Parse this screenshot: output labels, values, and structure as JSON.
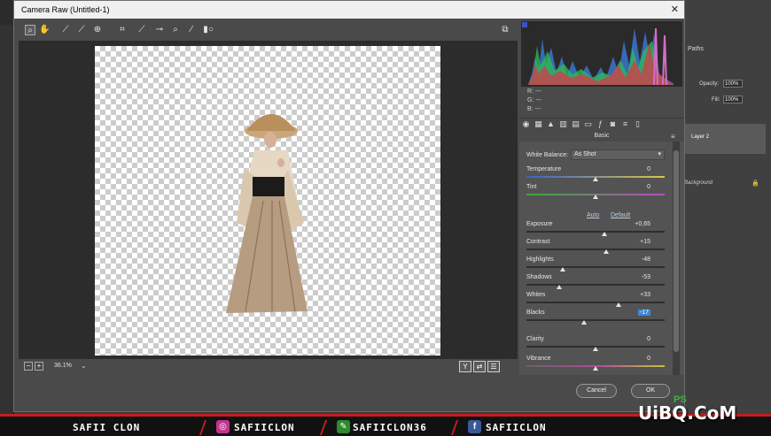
{
  "dialog": {
    "title": "Camera Raw (Untitled-1)",
    "close_glyph": "✕"
  },
  "toolbar": {
    "tools": [
      "zoom-icon",
      "hand-icon",
      "white-balance-icon",
      "color-sampler-icon",
      "targeted-adjustment-icon",
      "crop-icon",
      "straighten-icon",
      "spot-removal-icon",
      "red-eye-icon",
      "adjustment-brush-icon",
      "graduated-filter-icon",
      "radial-filter-icon"
    ],
    "open-preferences": "preferences-icon"
  },
  "status": {
    "zoom": "36.1%",
    "minus": "−",
    "plus": "+",
    "chevron": "⌄",
    "view_buttons": [
      "Y",
      "⇄",
      "☰"
    ]
  },
  "readout": {
    "r": "R:   ---",
    "g": "G:   ---",
    "b": "B:   ---"
  },
  "panel": {
    "title": "Basic",
    "white_balance_label": "White Balance:",
    "white_balance_value": "As Shot",
    "auto_label": "Auto",
    "default_label": "Default",
    "sliders": [
      {
        "id": "temperature",
        "label": "Temperature",
        "value": "0",
        "norm": 0.5,
        "track": "temp"
      },
      {
        "id": "tint",
        "label": "Tint",
        "value": "0",
        "norm": 0.5,
        "track": "tint"
      },
      {
        "id": "exposure",
        "label": "Exposure",
        "value": "+0,65",
        "norm": 0.565,
        "track": "plain"
      },
      {
        "id": "contrast",
        "label": "Contrast",
        "value": "+15",
        "norm": 0.575,
        "track": "plain"
      },
      {
        "id": "highlights",
        "label": "Highlights",
        "value": "-48",
        "norm": 0.26,
        "track": "plain"
      },
      {
        "id": "shadows",
        "label": "Shadows",
        "value": "-53",
        "norm": 0.235,
        "track": "plain"
      },
      {
        "id": "whites",
        "label": "Whites",
        "value": "+33",
        "norm": 0.665,
        "track": "plain"
      },
      {
        "id": "blacks",
        "label": "Blacks",
        "value": "-17",
        "norm": 0.415,
        "track": "plain",
        "selected": true
      },
      {
        "id": "clarity",
        "label": "Clarity",
        "value": "0",
        "norm": 0.5,
        "track": "plain"
      },
      {
        "id": "vibrance",
        "label": "Vibrance",
        "value": "0",
        "norm": 0.5,
        "track": "vib"
      }
    ]
  },
  "buttons": {
    "cancel": "Cancel",
    "ok": "OK"
  },
  "ps_panel": {
    "paths_tab": "Paths",
    "opacity_label": "Opacity:",
    "opacity_value": "100%",
    "fill_label": "Fill:",
    "fill_value": "100%",
    "layer2_name": "Layer 2",
    "background_name": "Background",
    "lock_glyph": "🔒"
  },
  "banner": {
    "name": "SAFII CLON",
    "instagram": "SAFIICLON",
    "other": "SAFIICLON36",
    "facebook": "SAFIICLON",
    "facebook_glyph": "f",
    "instagram_glyph": "◎",
    "other_glyph": "✎"
  },
  "watermark": {
    "main": "UiBQ.CoM",
    "sub": "PS"
  },
  "colors": {
    "accent_blue": "#3d86d8",
    "banner_red": "#c41e1e"
  }
}
